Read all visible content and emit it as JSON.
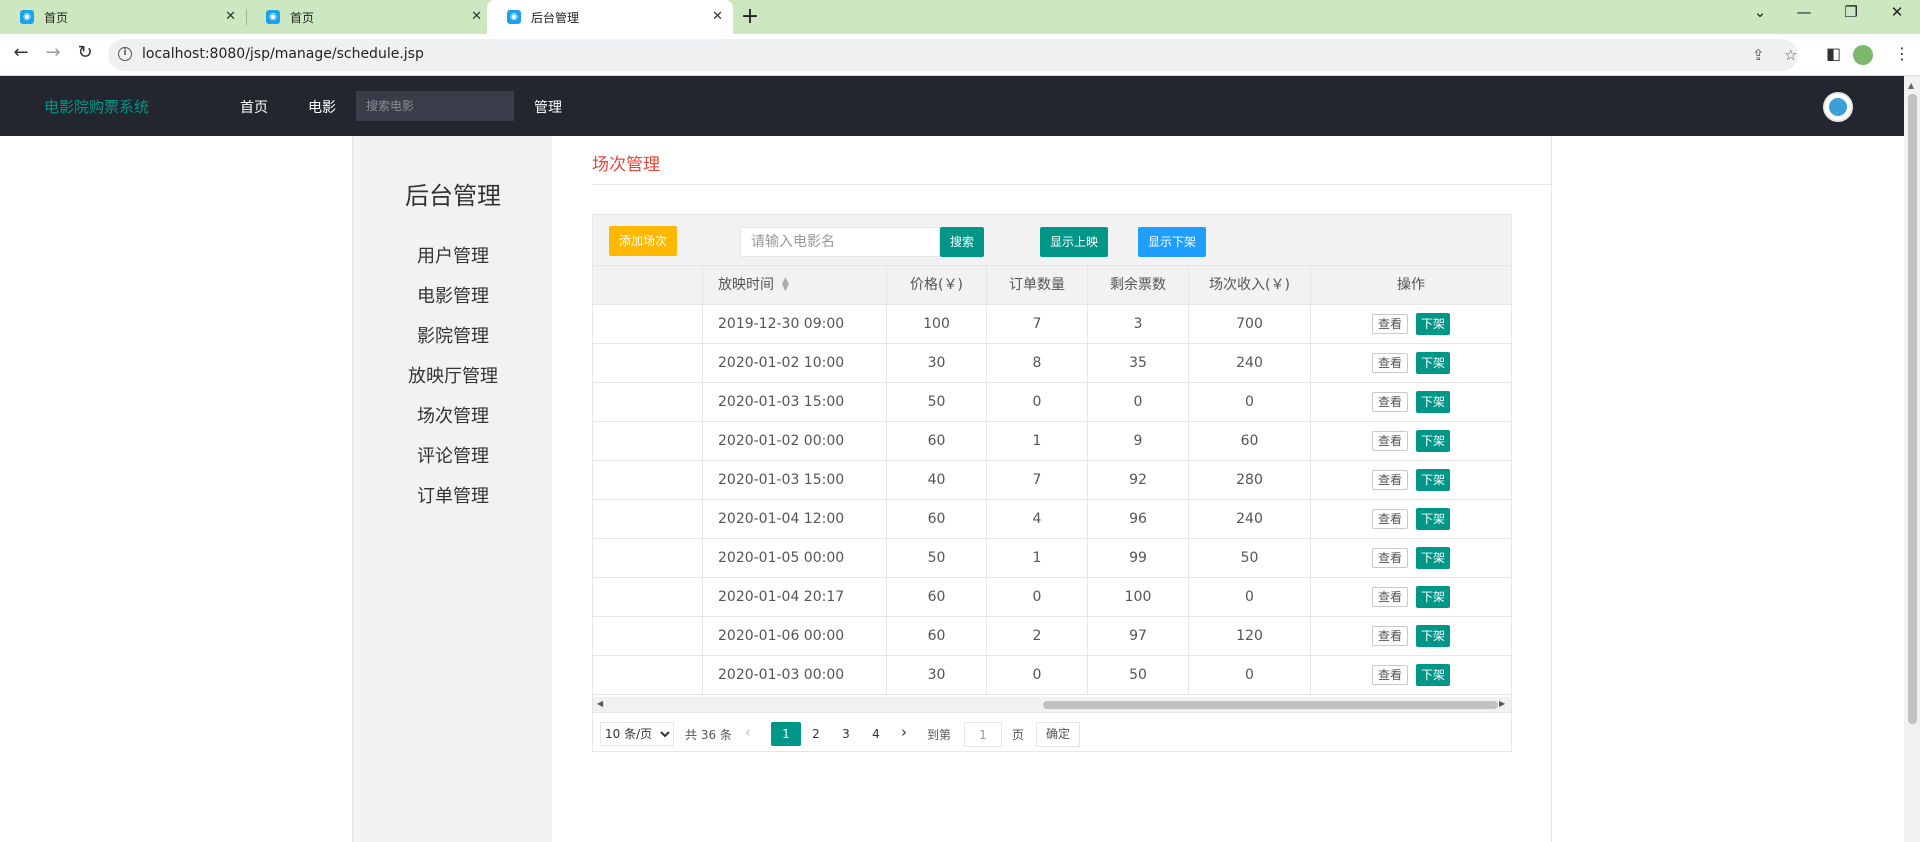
{
  "browser": {
    "tabs": [
      {
        "title": "首页",
        "active": false
      },
      {
        "title": "首页",
        "active": false
      },
      {
        "title": "后台管理",
        "active": true
      }
    ],
    "url": "localhost:8080/jsp/manage/schedule.jsp"
  },
  "appnav": {
    "brand": "电影院购票系统",
    "links": [
      "首页",
      "电影",
      "管理"
    ],
    "search_placeholder": "搜索电影"
  },
  "sidebar": {
    "title": "后台管理",
    "items": [
      "用户管理",
      "电影管理",
      "影院管理",
      "放映厅管理",
      "场次管理",
      "评论管理",
      "订单管理"
    ]
  },
  "main": {
    "title": "场次管理",
    "toolbar": {
      "add_label": "添加场次",
      "search_placeholder": "请输入电影名",
      "search_label": "搜索",
      "show_on_label": "显示上映",
      "show_off_label": "显示下架"
    },
    "columns": [
      "",
      "放映时间",
      "价格(￥)",
      "订单数量",
      "剩余票数",
      "场次收入(￥)",
      "操作"
    ],
    "row_actions": {
      "view": "查看",
      "off": "下架"
    },
    "rows": [
      {
        "name": "",
        "time": "2019-12-30 09:00",
        "price": "100",
        "orders": "7",
        "remaining": "3",
        "income": "700"
      },
      {
        "name": "",
        "time": "2020-01-02 10:00",
        "price": "30",
        "orders": "8",
        "remaining": "35",
        "income": "240"
      },
      {
        "name": "",
        "time": "2020-01-03 15:00",
        "price": "50",
        "orders": "0",
        "remaining": "0",
        "income": "0"
      },
      {
        "name": "",
        "time": "2020-01-02 00:00",
        "price": "60",
        "orders": "1",
        "remaining": "9",
        "income": "60"
      },
      {
        "name": "",
        "time": "2020-01-03 15:00",
        "price": "40",
        "orders": "7",
        "remaining": "92",
        "income": "280"
      },
      {
        "name": "",
        "time": "2020-01-04 12:00",
        "price": "60",
        "orders": "4",
        "remaining": "96",
        "income": "240"
      },
      {
        "name": "",
        "time": "2020-01-05 00:00",
        "price": "50",
        "orders": "1",
        "remaining": "99",
        "income": "50"
      },
      {
        "name": "",
        "time": "2020-01-04 20:17",
        "price": "60",
        "orders": "0",
        "remaining": "100",
        "income": "0"
      },
      {
        "name": "",
        "time": "2020-01-06 00:00",
        "price": "60",
        "orders": "2",
        "remaining": "97",
        "income": "120"
      },
      {
        "name": "",
        "time": "2020-01-03 00:00",
        "price": "30",
        "orders": "0",
        "remaining": "50",
        "income": "0"
      }
    ],
    "pager": {
      "page_size": "10 条/页",
      "total": "共 36 条",
      "pages": [
        "1",
        "2",
        "3",
        "4"
      ],
      "current": "1",
      "goto_prefix": "到第",
      "goto_value": "1",
      "goto_suffix": "页",
      "confirm": "确定"
    }
  },
  "colors": {
    "nav_bg": "#23262e",
    "brand": "#009688",
    "primary": "#009688",
    "warm": "#ffb800",
    "blue": "#1e9fff",
    "title_red": "#e8453c",
    "tabbar": "#cde8c1"
  }
}
